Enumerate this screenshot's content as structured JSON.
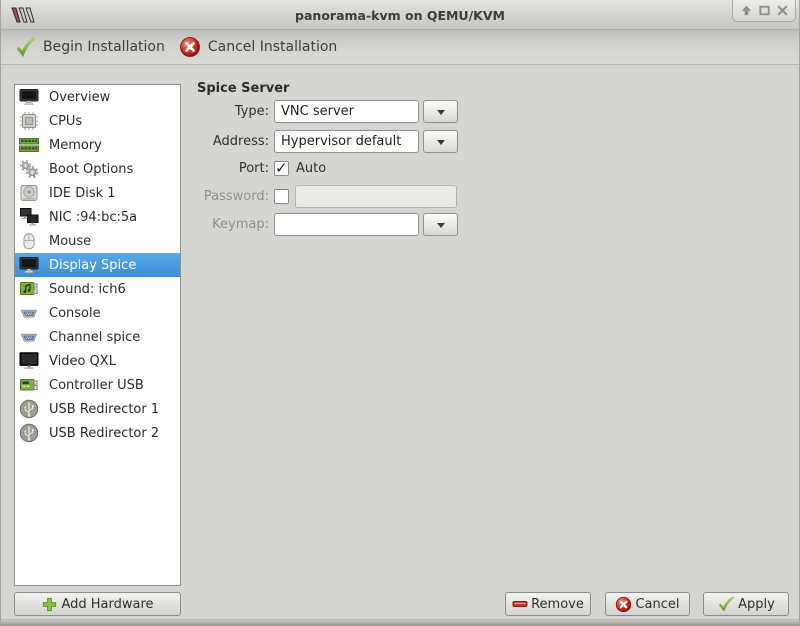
{
  "window": {
    "title": "panorama-kvm on QEMU/KVM",
    "controls": [
      "shade-icon",
      "maximize-icon",
      "close-icon"
    ]
  },
  "toolbar": {
    "begin_label": "Begin Installation",
    "cancel_label": "Cancel Installation"
  },
  "sidebar": {
    "items": [
      {
        "label": "Overview",
        "icon": "monitor-icon",
        "selected": false
      },
      {
        "label": "CPUs",
        "icon": "cpu-icon",
        "selected": false
      },
      {
        "label": "Memory",
        "icon": "memory-icon",
        "selected": false
      },
      {
        "label": "Boot Options",
        "icon": "gears-icon",
        "selected": false
      },
      {
        "label": "IDE Disk 1",
        "icon": "disk-icon",
        "selected": false
      },
      {
        "label": "NIC :94:bc:5a",
        "icon": "network-icon",
        "selected": false
      },
      {
        "label": "Mouse",
        "icon": "mouse-icon",
        "selected": false
      },
      {
        "label": "Display Spice",
        "icon": "monitor-icon",
        "selected": true
      },
      {
        "label": "Sound: ich6",
        "icon": "sound-card-icon",
        "selected": false
      },
      {
        "label": "Console",
        "icon": "serial-port-icon",
        "selected": false
      },
      {
        "label": "Channel spice",
        "icon": "serial-port-icon",
        "selected": false
      },
      {
        "label": "Video QXL",
        "icon": "video-icon",
        "selected": false
      },
      {
        "label": "Controller USB",
        "icon": "controller-icon",
        "selected": false
      },
      {
        "label": "USB Redirector 1",
        "icon": "usb-icon",
        "selected": false
      },
      {
        "label": "USB Redirector 2",
        "icon": "usb-icon",
        "selected": false
      }
    ],
    "add_hardware_label": "Add Hardware"
  },
  "panel": {
    "heading": "Spice Server",
    "type_label": "Type:",
    "type_value": "VNC server",
    "address_label": "Address:",
    "address_value": "Hypervisor default",
    "port_label": "Port:",
    "port_auto_label": "Auto",
    "port_auto_checked": true,
    "password_label": "Password:",
    "password_checked": false,
    "password_value": "",
    "keymap_label": "Keymap:",
    "keymap_value": ""
  },
  "footer": {
    "remove_label": "Remove",
    "cancel_label": "Cancel",
    "apply_label": "Apply"
  },
  "colors": {
    "selection_top": "#57a9e8",
    "selection_bottom": "#3d8ed9",
    "action_green": "#8bc34a",
    "action_red": "#d63b2c"
  }
}
